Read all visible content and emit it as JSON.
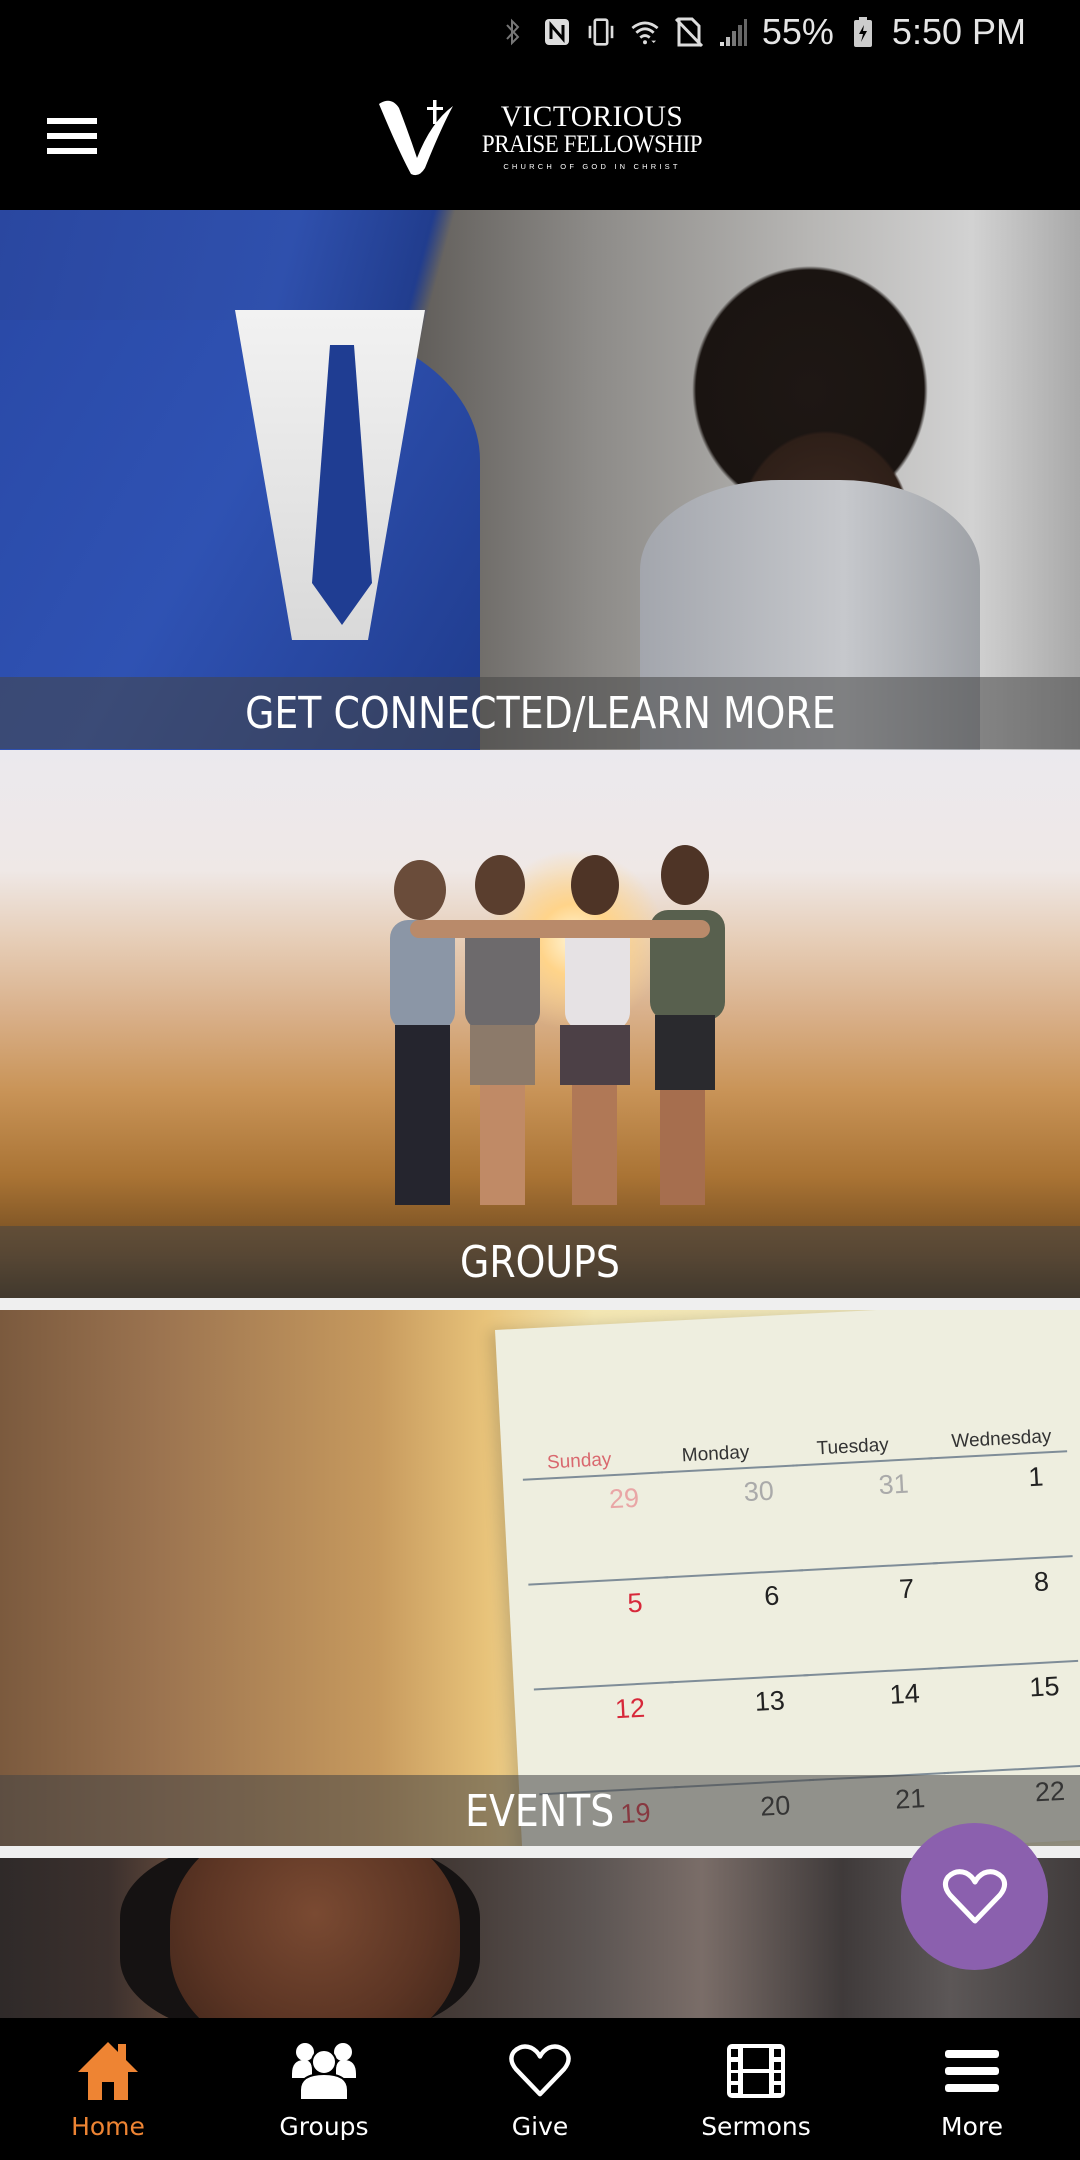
{
  "status_bar": {
    "icons": [
      "bluetooth-icon",
      "nfc-icon",
      "vibrate-icon",
      "wifi-icon",
      "no-sim-icon",
      "signal-icon",
      "battery-charging-icon"
    ],
    "battery": "55%",
    "time": "5:50 PM"
  },
  "header": {
    "menu_icon": "hamburger-menu-icon",
    "logo": {
      "line1": "VICTORIOUS",
      "line2": "PRAISE FELLOWSHIP",
      "line3": "CHURCH OF GOD IN CHRIST"
    }
  },
  "cards": [
    {
      "label": "GET CONNECTED/LEARN MORE",
      "image": "two people in business attire smiling"
    },
    {
      "label": "GROUPS",
      "image": "friends embracing at sunset"
    },
    {
      "label": "EVENTS",
      "image": "desk calendar"
    },
    {
      "label": "",
      "image": "woman with braids looking down"
    }
  ],
  "calendar_image": {
    "days": [
      "Sunday",
      "Monday",
      "Tuesday",
      "Wednesday"
    ],
    "rows": [
      [
        "29",
        "30",
        "31",
        "1"
      ],
      [
        "5",
        "6",
        "7",
        "8"
      ],
      [
        "12",
        "13",
        "14",
        "15"
      ],
      [
        "19",
        "20",
        "21",
        "22"
      ]
    ]
  },
  "fab": {
    "icon": "heart-icon",
    "color": "#8b60ae"
  },
  "bottom_nav": {
    "active_color": "#ee8433",
    "items": [
      {
        "label": "Home",
        "icon": "home-icon",
        "active": true
      },
      {
        "label": "Groups",
        "icon": "groups-icon",
        "active": false
      },
      {
        "label": "Give",
        "icon": "heart-icon",
        "active": false
      },
      {
        "label": "Sermons",
        "icon": "film-icon",
        "active": false
      },
      {
        "label": "More",
        "icon": "menu-icon",
        "active": false
      }
    ]
  }
}
